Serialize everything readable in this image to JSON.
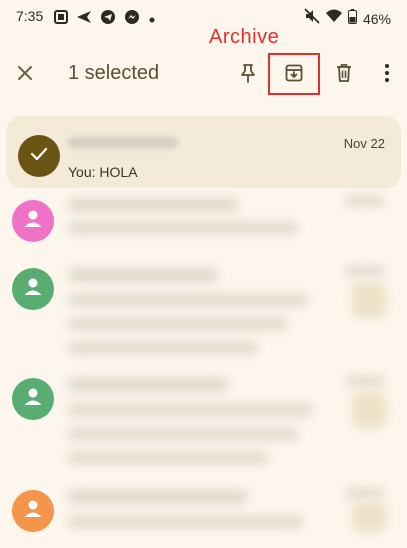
{
  "status_bar": {
    "time": "7:35",
    "battery": "46%",
    "icons": [
      "image-icon",
      "send-arrow-icon",
      "telegram-icon",
      "messenger-icon",
      "dot-icon",
      "mute-icon",
      "wifi-icon",
      "battery-icon"
    ]
  },
  "annotation": {
    "label": "Archive",
    "color": "#e32f2f"
  },
  "action_bar": {
    "selected_text": "1 selected",
    "icons": [
      "close-icon",
      "pin-icon",
      "archive-icon",
      "delete-icon",
      "more-vert-icon"
    ]
  },
  "conversations": [
    {
      "selected": true,
      "date": "Nov 22",
      "snippet": "You: HOLA",
      "avatar": "check-icon",
      "color": "#6a5514"
    },
    {
      "avatar": "person-icon",
      "color": "#ee72c5"
    },
    {
      "avatar": "person-icon",
      "color": "#59ad73"
    },
    {
      "avatar": "person-icon",
      "color": "#59ad73"
    },
    {
      "avatar": "person-icon",
      "color": "#f4954b"
    }
  ]
}
